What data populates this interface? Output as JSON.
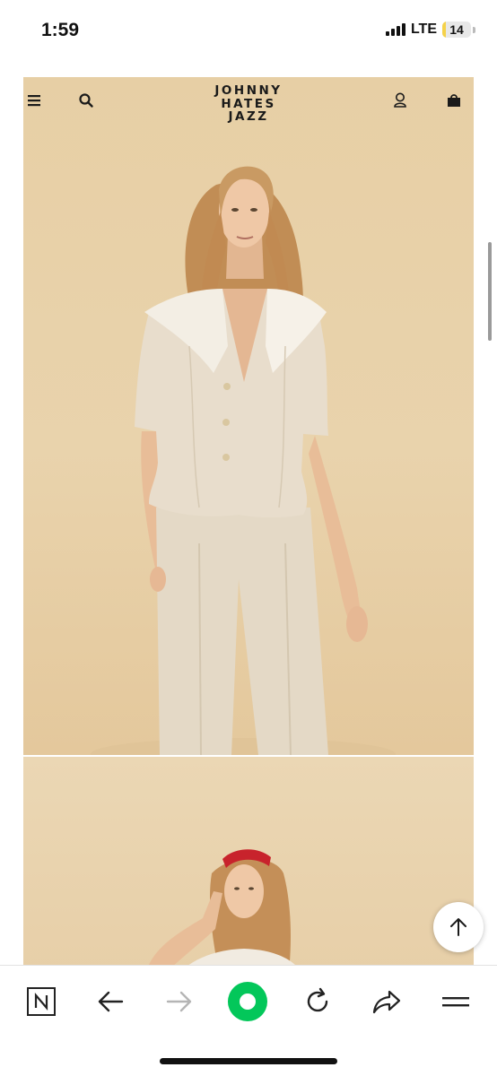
{
  "status_bar": {
    "time": "1:59",
    "network": "LTE",
    "battery": "14",
    "battery_level": 0.14
  },
  "site": {
    "logo_lines": [
      "JOHNNY",
      "HATES",
      "JAZZ"
    ],
    "icons": {
      "menu": "menu-icon",
      "search": "search-icon",
      "account": "user-icon",
      "bag": "shopping-bag-icon"
    }
  },
  "colors": {
    "backdrop": "#e7cfa5",
    "suit": "#e6dccb",
    "collar": "#f4efe6",
    "hair": "#c9955a",
    "headband": "#c8232c",
    "browser_accent": "#03c75a"
  },
  "floating": {
    "scroll_top": "arrow-up-icon"
  },
  "browser_toolbar": {
    "items": [
      "n-logo-icon",
      "back-arrow-icon",
      "forward-arrow-icon",
      "home-icon",
      "refresh-icon",
      "share-icon",
      "menu-icon"
    ]
  }
}
